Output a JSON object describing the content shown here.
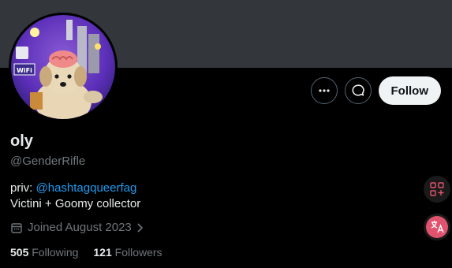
{
  "profile": {
    "name": "oly",
    "handle": "@GenderRifle",
    "bio_prefix": "priv: ",
    "bio_link": "@hashtagqueerfag",
    "bio_line2": "Victini + Goomy collector",
    "joined": "Joined August 2023",
    "following_count": "505",
    "following_label": "Following",
    "followers_count": "121",
    "followers_label": "Followers"
  },
  "actions": {
    "more_icon": "more-horizontal-icon",
    "message_icon": "chat-bubble-icon",
    "follow_label": "Follow"
  },
  "avatar": {
    "sticker_text": "WiFi"
  },
  "colors": {
    "banner": "#33363b",
    "link": "#1d9bf0",
    "muted": "#71767b",
    "text": "#e7e9ea",
    "follow_bg": "#eff3f4",
    "side_tool_accent": "#e0536e"
  }
}
